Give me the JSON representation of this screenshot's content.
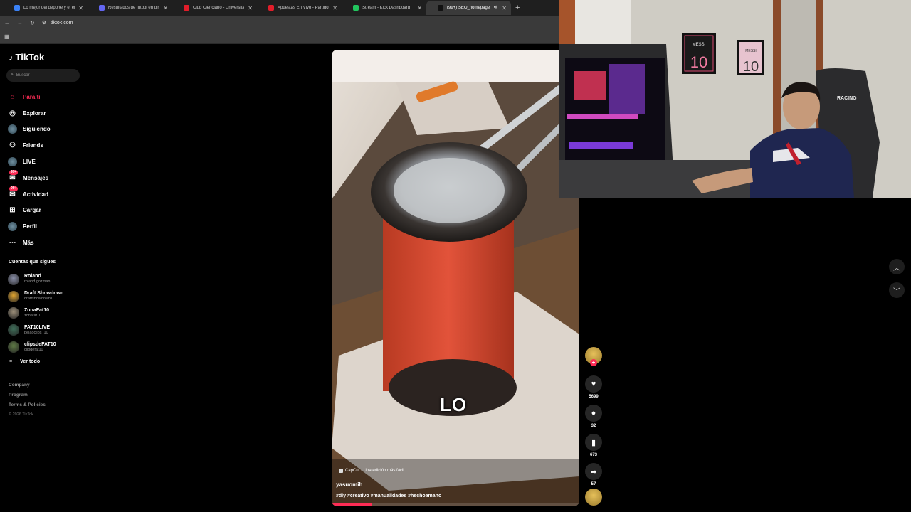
{
  "browser": {
    "tabs": [
      {
        "title": "Lo mejor del deporte y el entret",
        "color": "#3b82f6",
        "active": false
      },
      {
        "title": "Resultados de fútbol en directo",
        "color": "#6366f1",
        "active": false
      },
      {
        "title": "Club Cienciano - Universitario de",
        "color": "#e11d2a",
        "active": false
      },
      {
        "title": "Apuestas En Vivo - Partidos de",
        "color": "#e11d2a",
        "active": false
      },
      {
        "title": "Stream - Kick Dashboard",
        "color": "#22c55e",
        "active": false
      },
      {
        "title": "(99+) SEO_homepage_title",
        "color": "#111111",
        "active": true
      }
    ],
    "url": "tiktok.com"
  },
  "sidebar": {
    "brand": "TikTok",
    "search_placeholder": "Buscar",
    "nav": [
      {
        "label": "Para ti",
        "icon": "home-icon",
        "active": true
      },
      {
        "label": "Explorar",
        "icon": "compass-icon",
        "active": false
      },
      {
        "label": "Siguiendo",
        "icon": "following-avatar-icon",
        "active": false
      },
      {
        "label": "Friends",
        "icon": "friends-icon",
        "active": false
      },
      {
        "label": "LIVE",
        "icon": "live-avatar-icon",
        "active": false
      },
      {
        "label": "Mensajes",
        "icon": "messages-icon",
        "active": false,
        "badge": "99+"
      },
      {
        "label": "Actividad",
        "icon": "activity-icon",
        "active": false,
        "badge": "99+"
      },
      {
        "label": "Cargar",
        "icon": "upload-icon",
        "active": false
      },
      {
        "label": "Perfil",
        "icon": "profile-avatar-icon",
        "active": false
      },
      {
        "label": "Más",
        "icon": "more-icon",
        "active": false
      }
    ],
    "following_title": "Cuentas que sigues",
    "following": [
      {
        "name": "Roland",
        "handle": "roland.gozman",
        "color": "#8a8fa8"
      },
      {
        "name": "Draft Showdown",
        "handle": "draftshowdown1",
        "color": "#e0a531"
      },
      {
        "name": "ZonaFat10",
        "handle": "zonafat10",
        "color": "#9c8f7a"
      },
      {
        "name": "FAT10LIVE",
        "handle": "pelaoclips_10",
        "color": "#3f6f5a"
      },
      {
        "name": "clipsdeFAT10",
        "handle": "clipdefat10",
        "color": "#5f7a46"
      }
    ],
    "see_all": "Ver todo",
    "footer": [
      "Company",
      "Program",
      "Terms & Policies"
    ],
    "copyright": "© 2026 TikTok"
  },
  "video": {
    "author": "yasuomih",
    "hashtags": "#diy #creativo #manualidades #hechoamano",
    "capcut_label": "CapCut · Una edición más fácil",
    "caption_overlay": "LO",
    "progress": 0.16
  },
  "actions": {
    "likes": "5699",
    "comments": "32",
    "saves": "673",
    "shares": "57"
  },
  "webcam": {
    "jersey_1": "10",
    "jersey_1_name": "MESSI",
    "jersey_2": "10",
    "jersey_2_name": "MESSI",
    "chair_brand": "RACING"
  }
}
